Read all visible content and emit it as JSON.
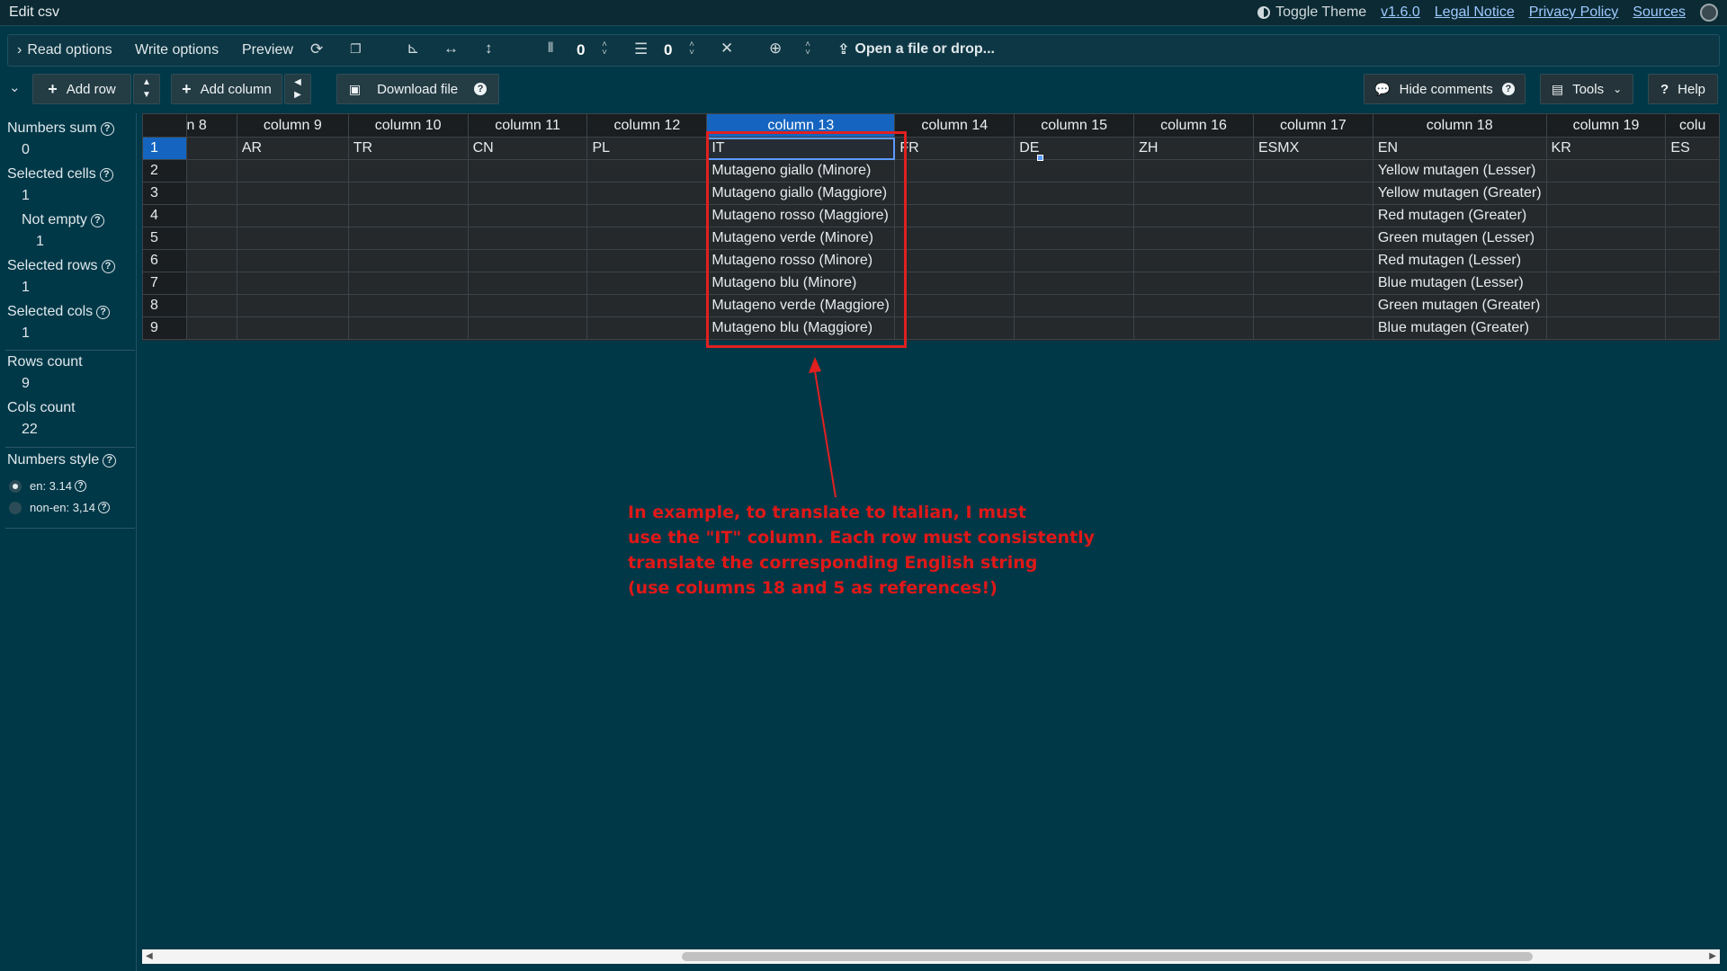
{
  "titlebar": {
    "title": "Edit csv",
    "toggle_theme": "Toggle Theme",
    "version": "v1.6.0",
    "legal": "Legal Notice",
    "privacy": "Privacy Policy",
    "sources": "Sources"
  },
  "toolbar": {
    "read_options": "Read options",
    "write_options": "Write options",
    "preview": "Preview",
    "fixed_cols_value": "0",
    "fixed_rows_value": "0",
    "open_file": "Open a file or drop..."
  },
  "actions": {
    "add_row": "Add row",
    "add_column": "Add column",
    "download_file": "Download file",
    "hide_comments": "Hide comments",
    "tools": "Tools",
    "help": "Help"
  },
  "stats": {
    "numbers_sum_label": "Numbers sum",
    "numbers_sum": "0",
    "selected_cells_label": "Selected cells",
    "selected_cells": "1",
    "not_empty_label": "Not empty",
    "not_empty": "1",
    "selected_rows_label": "Selected rows",
    "selected_rows": "1",
    "selected_cols_label": "Selected cols",
    "selected_cols": "1",
    "rows_count_label": "Rows count",
    "rows_count": "9",
    "cols_count_label": "Cols count",
    "cols_count": "22",
    "numbers_style_label": "Numbers style",
    "style_en": "en: 3.14",
    "style_non_en": "non-en: 3,14"
  },
  "grid": {
    "headers": [
      "n 8",
      "column 9",
      "column 10",
      "column 11",
      "column 12",
      "column 13",
      "column 14",
      "column 15",
      "column 16",
      "column 17",
      "column 18",
      "column 19",
      "colu"
    ],
    "rows": [
      [
        "1",
        "",
        "AR",
        "TR",
        "CN",
        "PL",
        "IT",
        "FR",
        "DE",
        "ZH",
        "ESMX",
        "EN",
        "KR",
        "ES"
      ],
      [
        "2",
        "",
        "",
        "",
        "",
        "",
        "Mutageno giallo (Minore)",
        "",
        "",
        "",
        "",
        "Yellow mutagen (Lesser)",
        "",
        ""
      ],
      [
        "3",
        "",
        "",
        "",
        "",
        "",
        "Mutageno giallo (Maggiore)",
        "",
        "",
        "",
        "",
        "Yellow mutagen (Greater)",
        "",
        ""
      ],
      [
        "4",
        "",
        "",
        "",
        "",
        "",
        "Mutageno rosso (Maggiore)",
        "",
        "",
        "",
        "",
        "Red mutagen (Greater)",
        "",
        ""
      ],
      [
        "5",
        "",
        "",
        "",
        "",
        "",
        "Mutageno verde (Minore)",
        "",
        "",
        "",
        "",
        "Green mutagen (Lesser)",
        "",
        ""
      ],
      [
        "6",
        "",
        "",
        "",
        "",
        "",
        "Mutageno rosso (Minore)",
        "",
        "",
        "",
        "",
        "Red mutagen (Lesser)",
        "",
        ""
      ],
      [
        "7",
        "",
        "",
        "",
        "",
        "",
        "Mutageno blu (Minore)",
        "",
        "",
        "",
        "",
        "Blue mutagen (Lesser)",
        "",
        ""
      ],
      [
        "8",
        "",
        "",
        "",
        "",
        "",
        "Mutageno verde (Maggiore)",
        "",
        "",
        "",
        "",
        "Green mutagen (Greater)",
        "",
        ""
      ],
      [
        "9",
        "",
        "",
        "",
        "",
        "",
        "Mutageno blu (Maggiore)",
        "",
        "",
        "",
        "",
        "Blue mutagen (Greater)",
        "",
        ""
      ]
    ]
  },
  "annotation": {
    "lines": [
      "In example, to translate to Italian, I must",
      "use the \"IT\" column. Each row must consistently",
      "translate the corresponding English string",
      "(use columns 18 and 5 as references!)"
    ],
    "color": "#e01818"
  },
  "colors": {
    "background": "#013848",
    "selection": "#1565c0",
    "grid": "#24292c",
    "link": "#9ec9ff"
  }
}
